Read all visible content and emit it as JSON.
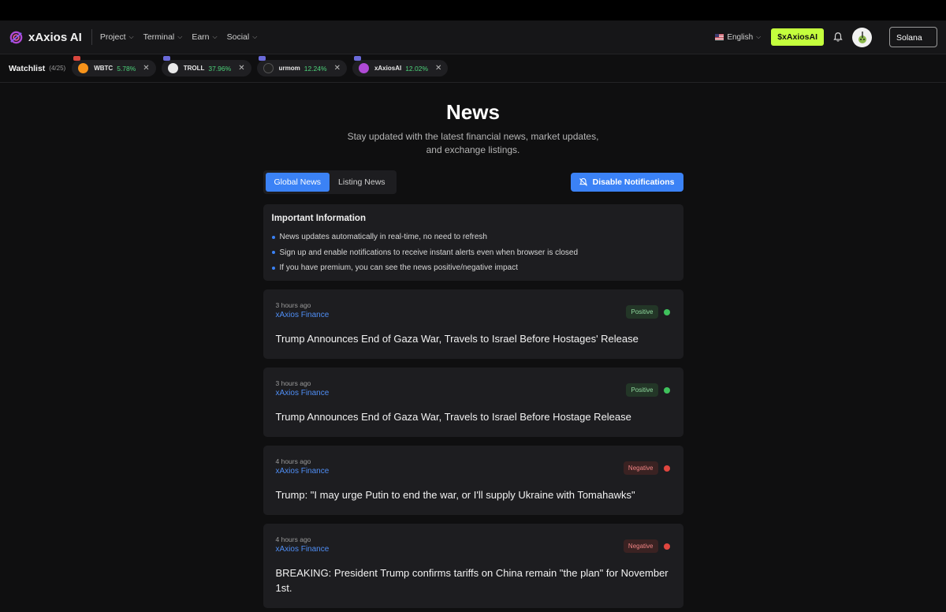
{
  "brand": {
    "name": "xAxios AI"
  },
  "nav": {
    "menu": [
      "Project",
      "Terminal",
      "Earn",
      "Social"
    ],
    "language": "English",
    "token_button": "$xAxiosAI",
    "wallet_button": "Solana"
  },
  "watchlist": {
    "title": "Watchlist",
    "count": "(4/25)",
    "items": [
      {
        "symbol": "WBTC",
        "change": "5.78%",
        "icon_color": "#f7931a",
        "mark_color": "#d9473e"
      },
      {
        "symbol": "TROLL",
        "change": "37.96%",
        "icon_color": "#e9e9e9",
        "mark_color": "#6a6ad8"
      },
      {
        "symbol": "urmom",
        "change": "12.24%",
        "icon_color": "#222222",
        "mark_color": "#6a6ad8"
      },
      {
        "symbol": "xAxiosAI",
        "change": "12.02%",
        "icon_color": "#b04ad6",
        "mark_color": "#6a6ad8"
      }
    ]
  },
  "hero": {
    "title": "News",
    "subtitle": "Stay updated with the latest financial news, market updates, and exchange listings."
  },
  "tabs": [
    {
      "label": "Global News",
      "active": true
    },
    {
      "label": "Listing News",
      "active": false
    }
  ],
  "notifications_button": "Disable Notifications",
  "info": {
    "title": "Important Information",
    "items": [
      "News updates automatically in real-time, no need to refresh",
      "Sign up and enable notifications to receive instant alerts even when browser is closed",
      "If you have premium, you can see the news positive/negative impact"
    ]
  },
  "news": [
    {
      "time": "3 hours ago",
      "source": "xAxios Finance",
      "headline": "Trump Announces End of Gaza War, Travels to Israel Before Hostages' Release",
      "sentiment": "Positive"
    },
    {
      "time": "3 hours ago",
      "source": "xAxios Finance",
      "headline": "Trump Announces End of Gaza War, Travels to Israel Before Hostage Release",
      "sentiment": "Positive"
    },
    {
      "time": "4 hours ago",
      "source": "xAxios Finance",
      "headline": "Trump: \"I may urge Putin to end the war, or I'll supply Ukraine with Tomahawks\"",
      "sentiment": "Negative"
    },
    {
      "time": "4 hours ago",
      "source": "xAxios Finance",
      "headline": "BREAKING: President Trump confirms tariffs on China remain \"the plan\" for November 1st.",
      "sentiment": "Negative"
    }
  ],
  "colors": {
    "accent": "#3b82f6",
    "token": "#c4ff3d",
    "positive": "#3fc15c",
    "negative": "#e0463f"
  }
}
